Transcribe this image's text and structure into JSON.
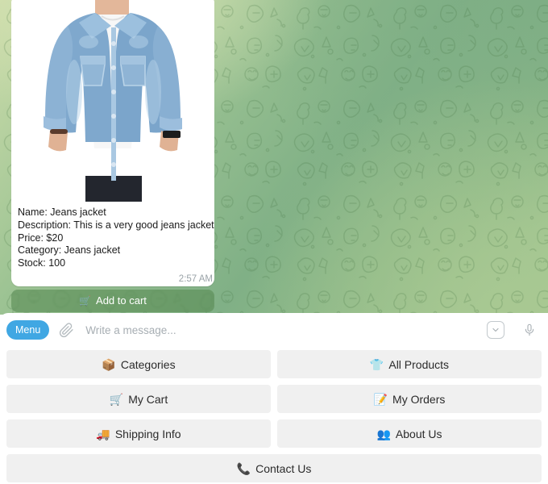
{
  "chat": {
    "background_colors": {
      "light": "#cbdcaa",
      "mid": "#9cc393",
      "dark": "#7eae85"
    },
    "message": {
      "photo_alt": "jeans-jacket-product-photo",
      "caption_lines": [
        "Name: Jeans jacket",
        "Description: This is a very good jeans jacket",
        "Price: $20",
        "Category: Jeans jacket",
        "Stock: 100"
      ],
      "timestamp": "2:57 AM",
      "inline_button": {
        "icon": "shopping-cart-emoji",
        "emoji": "🛒",
        "label": "Add to cart"
      }
    }
  },
  "input_bar": {
    "menu_label": "Menu",
    "menu_color": "#40a7e3",
    "attach_icon": "paperclip-icon",
    "placeholder": "Write a message...",
    "value": "",
    "emoji_icon": "chevron-down-icon",
    "mic_icon": "microphone-icon"
  },
  "keyboard": {
    "rows": [
      [
        {
          "emoji": "📦",
          "icon": "package-emoji",
          "label": "Categories"
        },
        {
          "emoji": "👕",
          "icon": "tshirt-emoji",
          "label": "All Products"
        }
      ],
      [
        {
          "emoji": "🛒",
          "icon": "shopping-cart-emoji",
          "label": "My Cart"
        },
        {
          "emoji": "📝",
          "icon": "memo-emoji",
          "label": "My Orders"
        }
      ],
      [
        {
          "emoji": "🚚",
          "icon": "truck-emoji",
          "label": "Shipping Info"
        },
        {
          "emoji": "👥",
          "icon": "busts-emoji",
          "label": "About Us"
        }
      ],
      [
        {
          "emoji": "📞",
          "icon": "telephone-emoji",
          "label": "Contact Us"
        }
      ]
    ]
  }
}
